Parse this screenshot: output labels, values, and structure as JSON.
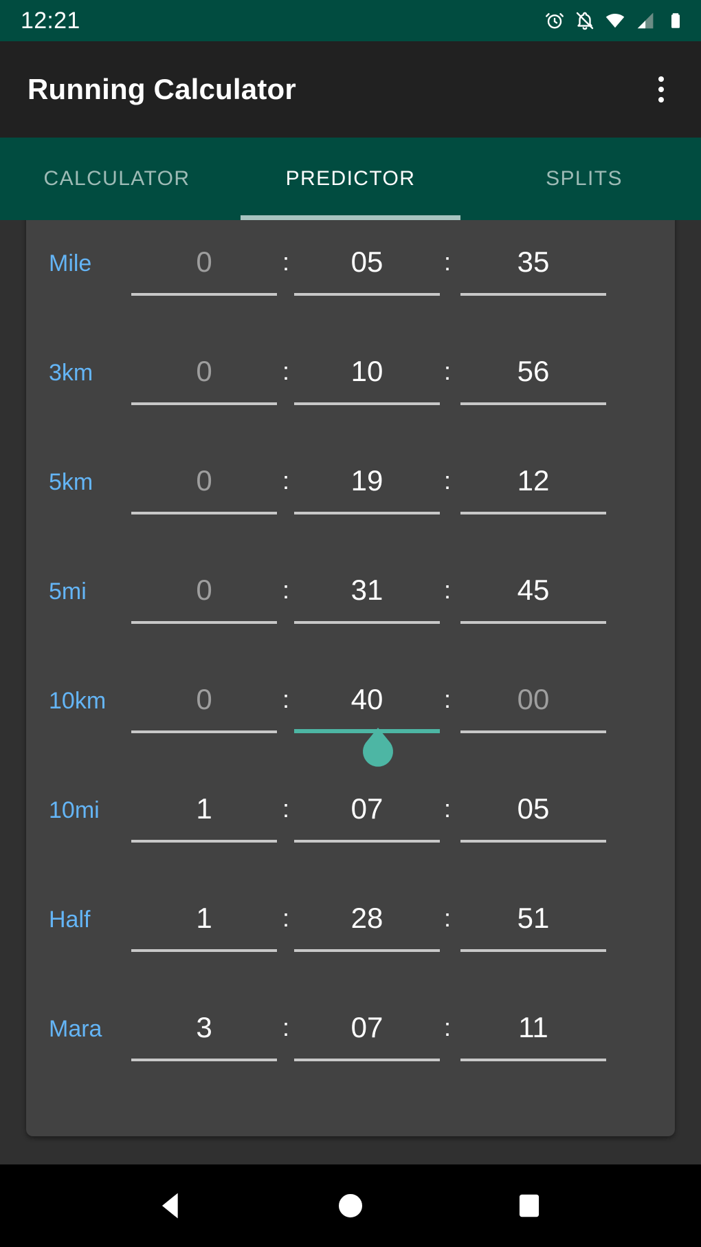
{
  "statusbar": {
    "time": "12:21",
    "icons": [
      "alarm-icon",
      "notifications-off-icon",
      "wifi-icon",
      "cellular-signal-icon",
      "battery-icon"
    ]
  },
  "appbar": {
    "title": "Running Calculator",
    "overflow_label": "more-options"
  },
  "tabs": [
    {
      "label": "CALCULATOR",
      "active": false
    },
    {
      "label": "PREDICTOR",
      "active": true
    },
    {
      "label": "SPLITS",
      "active": false
    }
  ],
  "colors": {
    "status_bar": "#014C40",
    "app_bar": "#212121",
    "tab_bar": "#014C40",
    "tab_indicator": "#A8C4C0",
    "card": "#424242",
    "page_background": "#303030",
    "label_blue": "#64B5F6",
    "accent_teal": "#4DB6A4",
    "value_white": "#FFFFFF",
    "placeholder_grey": "#9E9E9E",
    "underline_grey": "#C8C8C8",
    "nav_bar": "#000000"
  },
  "predictor": {
    "separator": ":",
    "partial_row_above": true,
    "rows": [
      {
        "label": "Mile",
        "hours": "0",
        "minutes": "05",
        "seconds": "35",
        "hours_placeholder": true,
        "minutes_placeholder": false,
        "seconds_placeholder": false,
        "focused": "none"
      },
      {
        "label": "3km",
        "hours": "0",
        "minutes": "10",
        "seconds": "56",
        "hours_placeholder": true,
        "minutes_placeholder": false,
        "seconds_placeholder": false,
        "focused": "none"
      },
      {
        "label": "5km",
        "hours": "0",
        "minutes": "19",
        "seconds": "12",
        "hours_placeholder": true,
        "minutes_placeholder": false,
        "seconds_placeholder": false,
        "focused": "none"
      },
      {
        "label": "5mi",
        "hours": "0",
        "minutes": "31",
        "seconds": "45",
        "hours_placeholder": true,
        "minutes_placeholder": false,
        "seconds_placeholder": false,
        "focused": "none"
      },
      {
        "label": "10km",
        "hours": "0",
        "minutes": "40",
        "seconds": "00",
        "hours_placeholder": true,
        "minutes_placeholder": false,
        "seconds_placeholder": true,
        "focused": "minutes"
      },
      {
        "label": "10mi",
        "hours": "1",
        "minutes": "07",
        "seconds": "05",
        "hours_placeholder": false,
        "minutes_placeholder": false,
        "seconds_placeholder": false,
        "focused": "none"
      },
      {
        "label": "Half",
        "hours": "1",
        "minutes": "28",
        "seconds": "51",
        "hours_placeholder": false,
        "minutes_placeholder": false,
        "seconds_placeholder": false,
        "focused": "none"
      },
      {
        "label": "Mara",
        "hours": "3",
        "minutes": "07",
        "seconds": "11",
        "hours_placeholder": false,
        "minutes_placeholder": false,
        "seconds_placeholder": false,
        "focused": "none"
      }
    ]
  },
  "navbar": {
    "buttons": [
      {
        "name": "back-button",
        "icon": "triangle-left-icon"
      },
      {
        "name": "home-button",
        "icon": "circle-icon"
      },
      {
        "name": "recents-button",
        "icon": "square-icon"
      }
    ]
  }
}
